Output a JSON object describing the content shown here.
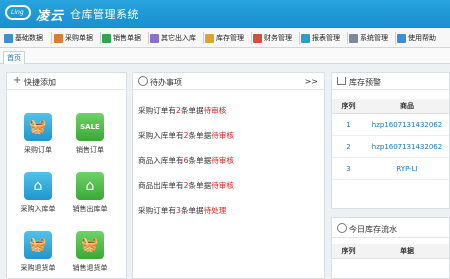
{
  "header": {
    "logo_text": "Ling",
    "brand": "凌云",
    "system_name": "仓库管理系统"
  },
  "navbar": {
    "items": [
      {
        "label": "基础数据",
        "icon": "database-icon",
        "color": "#3b8ed8"
      },
      {
        "label": "采购单据",
        "icon": "purchase-doc-icon",
        "color": "#e07b2a"
      },
      {
        "label": "销售单据",
        "icon": "sales-doc-icon",
        "color": "#2da84a"
      },
      {
        "label": "其它出入库",
        "icon": "transfer-icon",
        "color": "#8a6fd1"
      },
      {
        "label": "库存管理",
        "icon": "inventory-icon",
        "color": "#d8a628"
      },
      {
        "label": "财务管理",
        "icon": "finance-icon",
        "color": "#d84b3b"
      },
      {
        "label": "报表管理",
        "icon": "report-icon",
        "color": "#2a9fc9"
      },
      {
        "label": "系统管理",
        "icon": "settings-icon",
        "color": "#7a8a99"
      },
      {
        "label": "使用帮助",
        "icon": "help-icon",
        "color": "#3b8ed8"
      }
    ]
  },
  "tabs": [
    {
      "label": "首页"
    }
  ],
  "quick_add": {
    "title": "快捷添加",
    "items": [
      {
        "label": "采购订单",
        "icon": "basket-icon",
        "color": "blue"
      },
      {
        "label": "销售订单",
        "icon": "sale-sign-icon",
        "color": "green"
      },
      {
        "label": "采购入库单",
        "icon": "home-icon",
        "color": "blue"
      },
      {
        "label": "销售出库单",
        "icon": "home-icon",
        "color": "green"
      },
      {
        "label": "采购退货单",
        "icon": "basket-icon",
        "color": "blue"
      },
      {
        "label": "销售退货单",
        "icon": "basket-icon",
        "color": "green"
      }
    ]
  },
  "todo": {
    "title": "待办事项",
    "more": ">>",
    "items": [
      {
        "pre": "采购订单有",
        "num": "2",
        "mid": "条单据",
        "status": "待审核"
      },
      {
        "pre": "采购入库单有",
        "num": "2",
        "mid": "条单据",
        "status": "待审核"
      },
      {
        "pre": "商品入库单有",
        "num": "6",
        "mid": "条单据",
        "status": "待审核"
      },
      {
        "pre": "商品出库单有",
        "num": "2",
        "mid": "条单据",
        "status": "待审核"
      },
      {
        "pre": "采购订单有",
        "num": "3",
        "mid": "条单据",
        "status": "待处理"
      }
    ]
  },
  "stock_alert": {
    "title": "库存预警",
    "columns": [
      "序列",
      "商品"
    ],
    "rows": [
      {
        "index": "1",
        "product": "hzp1607131432062"
      },
      {
        "index": "2",
        "product": "hzp1607131432062"
      },
      {
        "index": "3",
        "product": "RYP-LI"
      }
    ]
  },
  "stock_flow": {
    "title": "今日库存流水",
    "columns": [
      "序列",
      "单据"
    ]
  },
  "colors": {
    "header_bg": "#1a8fcf",
    "accent_red": "#e02020",
    "link_blue": "#1878c9"
  }
}
